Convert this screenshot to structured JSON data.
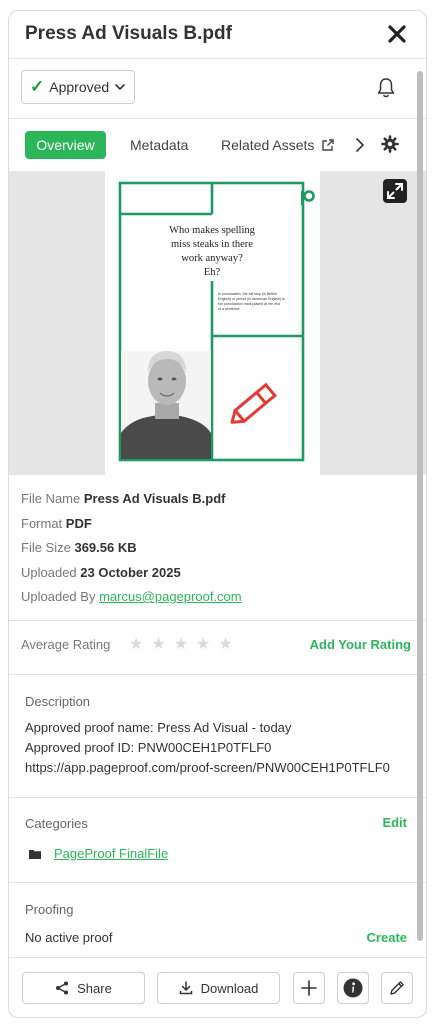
{
  "header": {
    "title": "Press Ad Visuals B.pdf"
  },
  "status": {
    "label": "Approved",
    "check_icon": "check-icon",
    "chevron_icon": "chevron-down-icon"
  },
  "tabs": {
    "overview": "Overview",
    "metadata": "Metadata",
    "related": "Related Assets"
  },
  "preview": {
    "headline_lines": [
      "Who makes spelling",
      "miss steaks in there",
      "work anyway?",
      "Eh?"
    ],
    "small_text_lines": [
      "In punctuation, the full stop (in British",
      "English) or period (in American English) is",
      "the punctuation mark placed at the end",
      "of a sentence."
    ],
    "accent_color": "#1e9a63",
    "pencil_color": "#e53935"
  },
  "file": {
    "name_label": "File Name",
    "name_value": "Press Ad Visuals B.pdf",
    "format_label": "Format",
    "format_value": "PDF",
    "size_label": "File Size",
    "size_value": "369.56 KB",
    "uploaded_label": "Uploaded",
    "uploaded_value": "23 October 2025",
    "uploaded_by_label": "Uploaded By",
    "uploaded_by_value": "marcus@pageproof.com"
  },
  "rating": {
    "label": "Average Rating",
    "stars": [
      "★",
      "★",
      "★",
      "★",
      "★"
    ],
    "value": 0,
    "add_label": "Add Your Rating"
  },
  "description": {
    "title": "Description",
    "lines": [
      "Approved proof name: Press Ad Visual - today",
      "Approved proof ID: PNW00CEH1P0TFLF0",
      "https://app.pageproof.com/proof-screen/PNW00CEH1P0TFLF0"
    ]
  },
  "categories": {
    "title": "Categories",
    "edit_label": "Edit",
    "items": [
      "PageProof FinalFile"
    ]
  },
  "proofing": {
    "title": "Proofing",
    "status": "No active proof",
    "create_label": "Create"
  },
  "footer": {
    "share_label": "Share",
    "download_label": "Download"
  },
  "colors": {
    "accent": "#2cb65a",
    "approved_check": "#1a9b3e"
  }
}
